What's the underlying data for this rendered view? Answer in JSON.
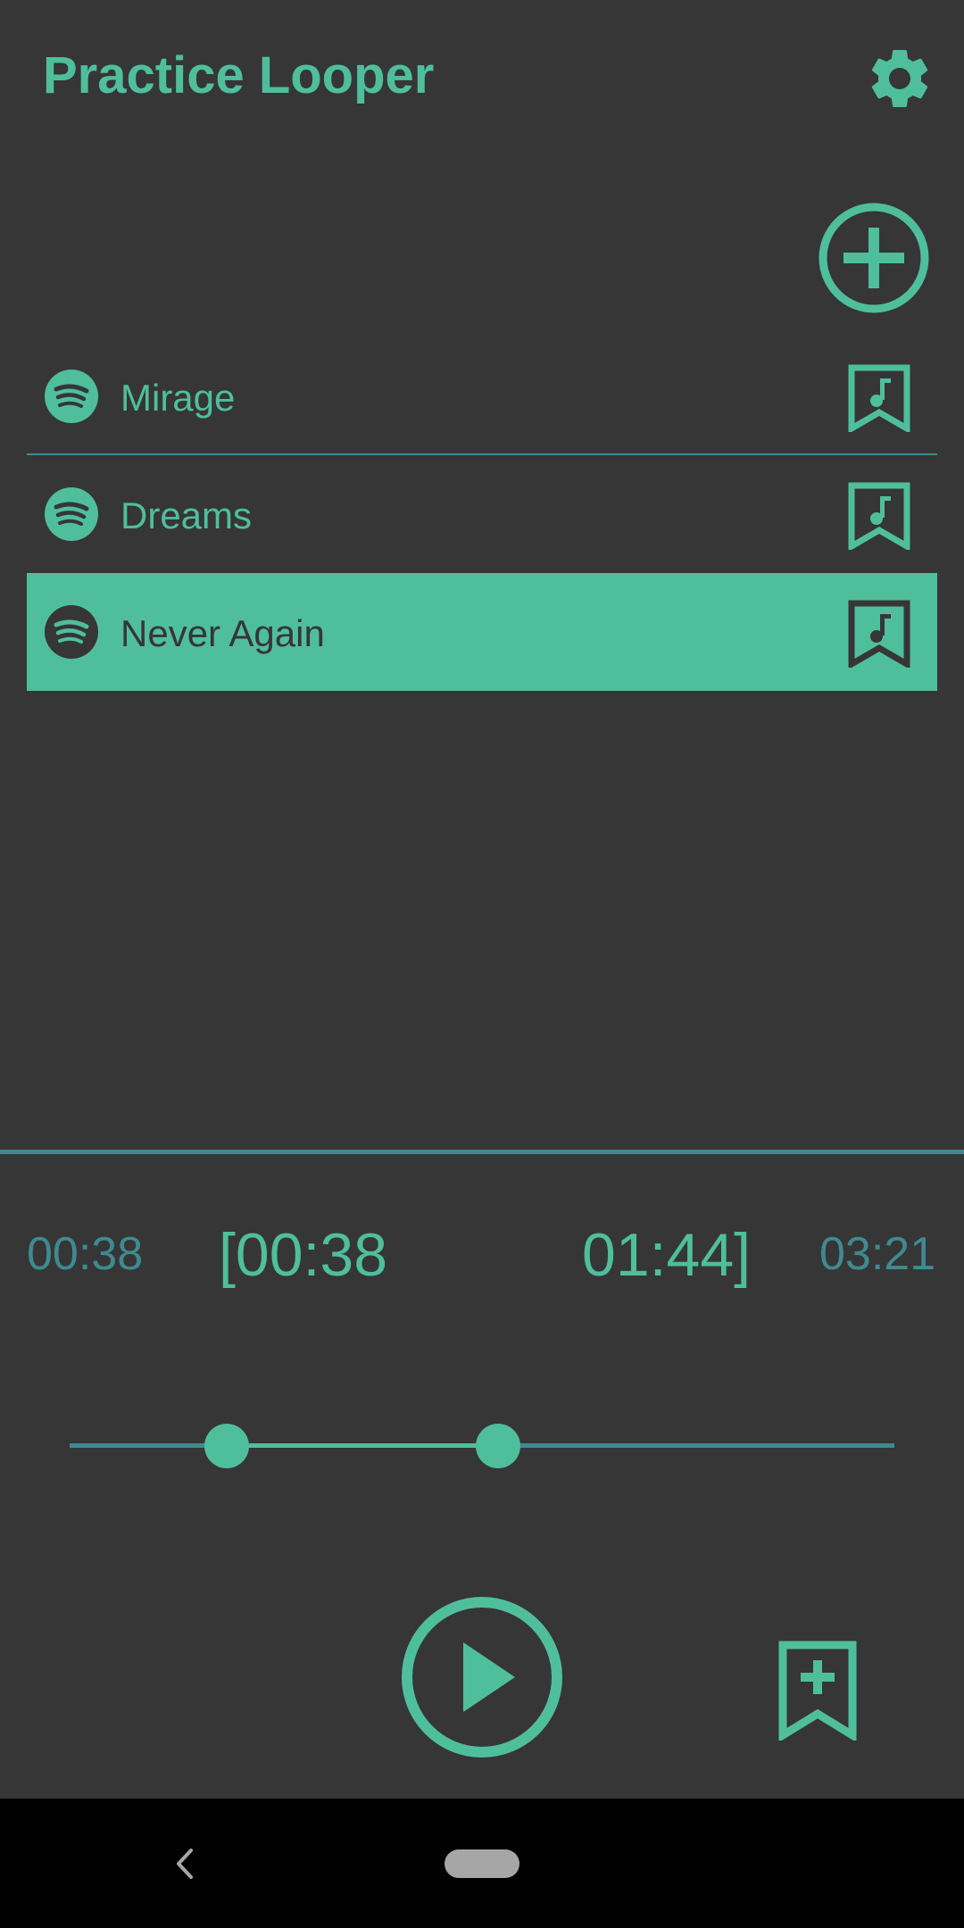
{
  "app": {
    "title": "Practice Looper"
  },
  "icons": {
    "settings": "gear-icon",
    "add": "plus-circle-icon",
    "song_source": "spotify-icon",
    "bookmark": "music-bookmark-icon",
    "play": "play-circle-icon",
    "add_bookmark": "bookmark-plus-icon",
    "nav_back": "chevron-left-icon"
  },
  "songs": [
    {
      "title": "Mirage",
      "selected": false
    },
    {
      "title": "Dreams",
      "selected": false
    },
    {
      "title": "Never Again",
      "selected": true
    }
  ],
  "player": {
    "current_time": "00:38",
    "loop_start": "[00:38",
    "loop_end": "01:44]",
    "total_time": "03:21",
    "loop_start_fraction": 0.19,
    "loop_end_fraction": 0.52
  },
  "colors": {
    "accent": "#4fbf9b",
    "secondary": "#3f8a91",
    "background": "#363636",
    "nav_bar": "#000000"
  }
}
